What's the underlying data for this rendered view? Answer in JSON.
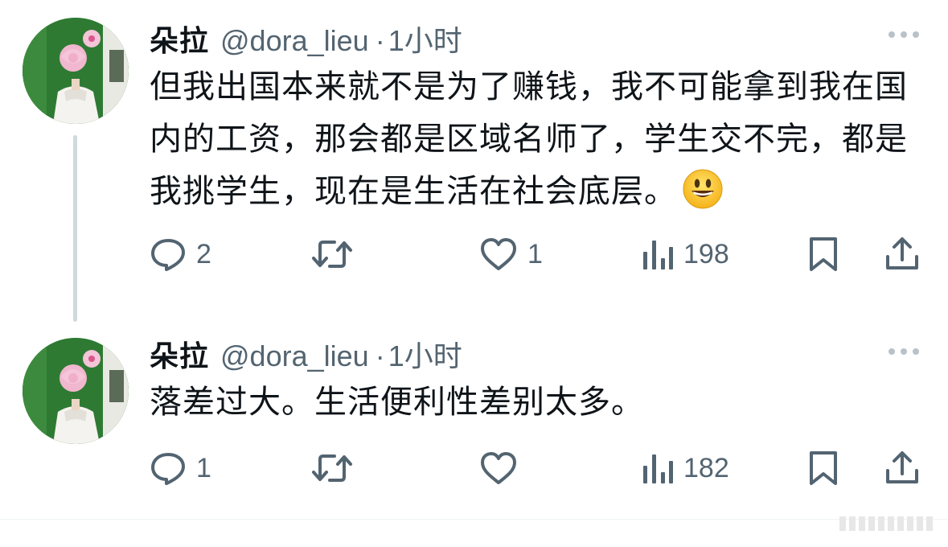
{
  "tweets": [
    {
      "display_name": "朵拉",
      "handle": "@dora_lieu",
      "separator": "·",
      "time": "1小时",
      "text": "但我出国本来就不是为了赚钱，我不可能拿到我在国内的工资，那会都是区域名师了，学生交不完，都是我挑学生，现在是生活在社会底层。",
      "emoji": "grinning-face-emoji",
      "actions": {
        "reply_count": "2",
        "retweet_count": "",
        "like_count": "1",
        "view_count": "198"
      }
    },
    {
      "display_name": "朵拉",
      "handle": "@dora_lieu",
      "separator": "·",
      "time": "1小时",
      "text": "落差过大。生活便利性差别太多。",
      "actions": {
        "reply_count": "1",
        "retweet_count": "",
        "like_count": "",
        "view_count": "182"
      }
    }
  ],
  "icons": {
    "reply": "reply-icon",
    "retweet": "retweet-icon",
    "like": "heart-icon",
    "views": "views-icon",
    "bookmark": "bookmark-icon",
    "share": "share-icon",
    "more": "more-icon"
  },
  "colors": {
    "text": "#0f1419",
    "secondary": "#536471",
    "thread_line": "#cfd9de",
    "avatar_bg": "#2f7a34"
  }
}
